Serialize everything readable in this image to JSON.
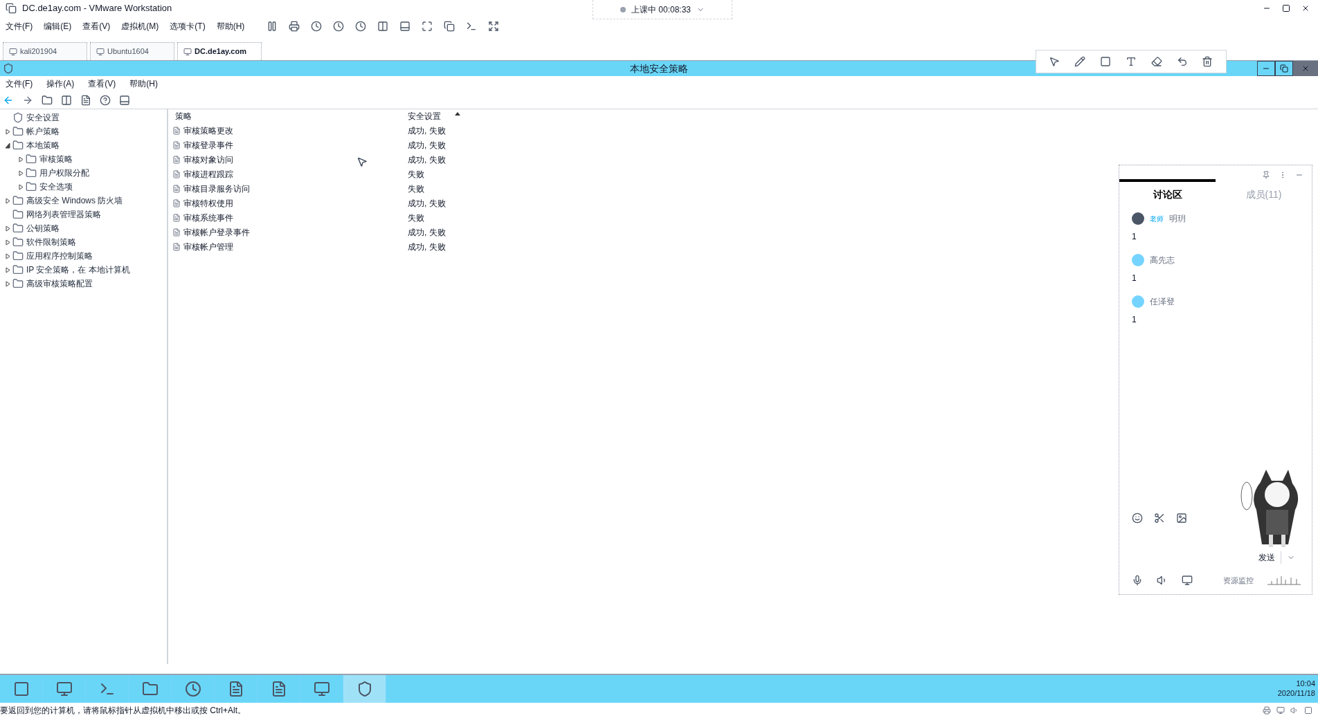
{
  "window": {
    "title": "DC.de1ay.com - VMware Workstation"
  },
  "menu": [
    "文件(F)",
    "编辑(E)",
    "查看(V)",
    "虚拟机(M)",
    "选项卡(T)",
    "帮助(H)"
  ],
  "session": {
    "label": "上课中 00:08:33"
  },
  "vm_tabs": [
    {
      "label": "kali201904",
      "selected": false
    },
    {
      "label": "Ubuntu1604",
      "selected": false
    },
    {
      "label": "DC.de1ay.com",
      "selected": true
    }
  ],
  "inner_window": {
    "title": "本地安全策略"
  },
  "inner_menu": [
    "文件(F)",
    "操作(A)",
    "查看(V)",
    "帮助(H)"
  ],
  "tree": {
    "root": "安全设置",
    "items": [
      {
        "label": "帐户策略",
        "expanded": false
      },
      {
        "label": "本地策略",
        "expanded": true,
        "children": [
          {
            "label": "审核策略",
            "expanded": false
          },
          {
            "label": "用户权限分配",
            "expanded": false
          },
          {
            "label": "安全选项",
            "expanded": false
          }
        ]
      },
      {
        "label": "高级安全 Windows 防火墙",
        "expanded": false
      },
      {
        "label": "网络列表管理器策略"
      },
      {
        "label": "公钥策略",
        "expanded": false
      },
      {
        "label": "软件限制策略",
        "expanded": false
      },
      {
        "label": "应用程序控制策略",
        "expanded": false
      },
      {
        "label": "IP 安全策略，在 本地计算机",
        "expanded": false
      },
      {
        "label": "高级审核策略配置",
        "expanded": false
      }
    ]
  },
  "table": {
    "columns": [
      "策略",
      "安全设置"
    ],
    "rows": [
      {
        "policy": "审核策略更改",
        "setting": "成功, 失败"
      },
      {
        "policy": "审核登录事件",
        "setting": "成功, 失败"
      },
      {
        "policy": "审核对象访问",
        "setting": "成功, 失败"
      },
      {
        "policy": "审核进程跟踪",
        "setting": "失败"
      },
      {
        "policy": "审核目录服务访问",
        "setting": "失败"
      },
      {
        "policy": "审核特权使用",
        "setting": "成功, 失败"
      },
      {
        "policy": "审核系统事件",
        "setting": "失败"
      },
      {
        "policy": "审核帐户登录事件",
        "setting": "成功, 失败"
      },
      {
        "policy": "审核帐户管理",
        "setting": "成功, 失败"
      }
    ]
  },
  "chat": {
    "tabs": [
      {
        "label": "讨论区",
        "selected": true
      },
      {
        "label": "成员(11)",
        "selected": false
      }
    ],
    "messages": [
      {
        "role": "老师",
        "name": "明玥",
        "text": "1"
      },
      {
        "name": "高先志",
        "text": "1"
      },
      {
        "name": "任泽登",
        "text": "1"
      }
    ],
    "send": "发送",
    "monitor": "资源监控"
  },
  "clock": {
    "time": "10:04",
    "date": "2020/11/18"
  },
  "status_bar": "要返回到您的计算机，请将鼠标指针从虚拟机中移出或按 Ctrl+Alt。"
}
